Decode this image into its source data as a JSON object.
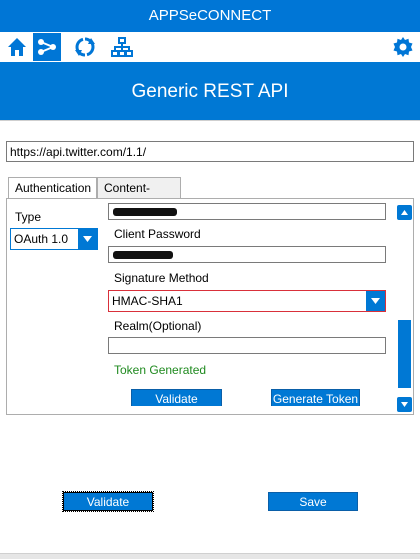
{
  "window": {
    "title": "APPSeCONNECT"
  },
  "toolbar": {
    "icons": [
      "home-icon",
      "connect-icon",
      "sync-icon",
      "hierarchy-icon",
      "gear-icon"
    ],
    "accent": "#0076d6"
  },
  "header": {
    "title": "Generic REST API"
  },
  "form": {
    "url_value": "https://api.twitter.com/1.1/",
    "tabs": [
      {
        "label": "Authentication",
        "active": true
      },
      {
        "label": "Content-Type",
        "active": false
      }
    ],
    "auth": {
      "type_label": "Type",
      "type_value": "OAuth 1.0",
      "client_password_label": "Client Password",
      "signature_method_label": "Signature Method",
      "signature_method_value": "HMAC-SHA1",
      "realm_label": "Realm(Optional)",
      "realm_value": "",
      "token_status": "Token Generated",
      "validate_label": "Validate",
      "generate_token_label": "Generate Token"
    }
  },
  "footer": {
    "validate_label": "Validate",
    "save_label": "Save"
  },
  "colors": {
    "primary": "#0078d4",
    "success": "#1f8a1f",
    "error_border": "#d9303a"
  }
}
